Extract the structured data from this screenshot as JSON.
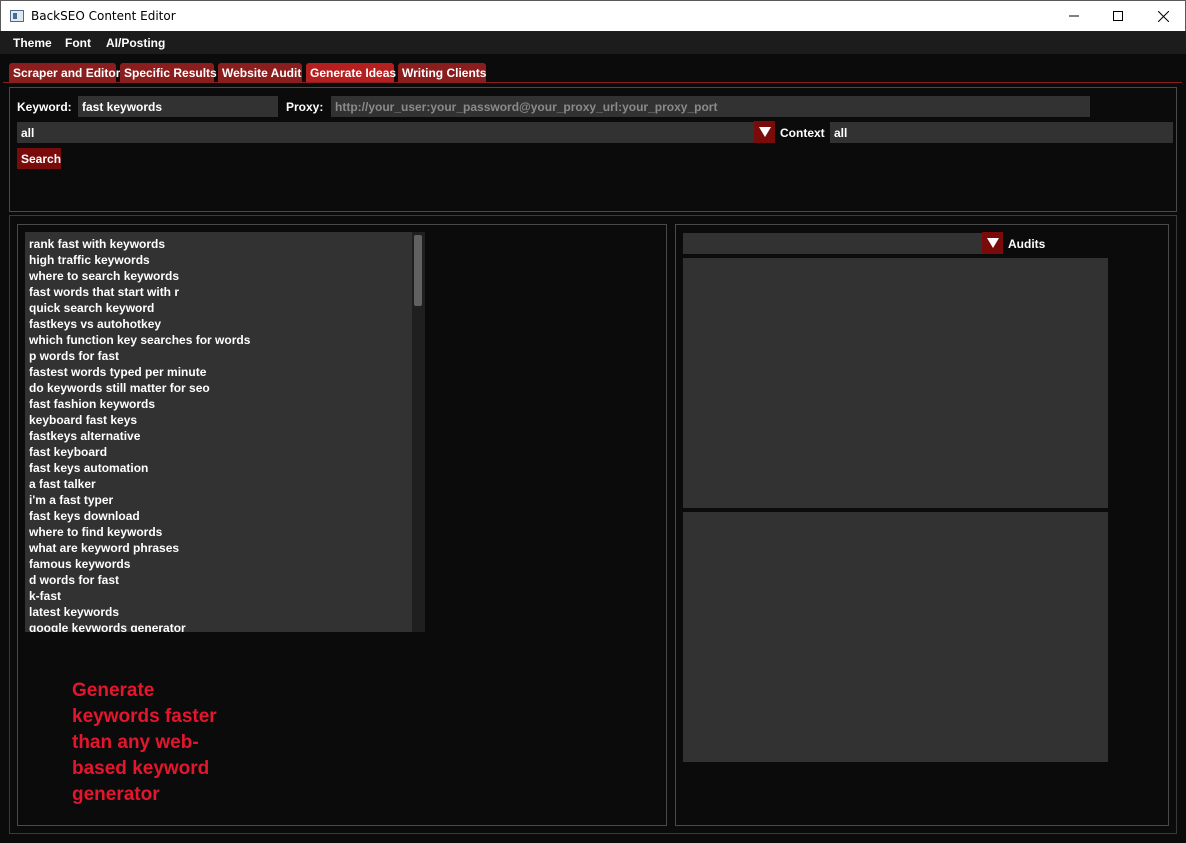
{
  "window": {
    "title": "BackSEO Content Editor",
    "controls": {
      "minimize": "minimize-icon",
      "maximize": "maximize-icon",
      "close": "close-icon"
    }
  },
  "menu": [
    "Theme",
    "Font",
    "AI/Posting"
  ],
  "tabs": [
    {
      "label": "Scraper and Editor"
    },
    {
      "label": "Specific Results"
    },
    {
      "label": "Website Audit"
    },
    {
      "label": "Generate Ideas",
      "active": true
    },
    {
      "label": "Writing Clients"
    }
  ],
  "search": {
    "keyword_label": "Keyword:",
    "keyword_value": "fast keywords",
    "proxy_label": "Proxy:",
    "proxy_placeholder": "http://your_user:your_password@your_proxy_url:your_proxy_port",
    "source_select": "all",
    "context_label": "Context",
    "context_value": "all",
    "search_button": "Search"
  },
  "keywords": [
    " rank fast with keywords",
    "high traffic keywords",
    "where to search keywords",
    "fast words that start with r",
    "quick search keyword",
    "fastkeys vs autohotkey",
    "which function key searches for words",
    "p words for fast",
    "fastest words typed per minute",
    "do keywords still matter for seo",
    "fast fashion keywords",
    "keyboard fast keys",
    "fastkeys alternative",
    "fast keyboard",
    "fast keys automation",
    "a fast talker",
    "i'm a fast typer",
    "fast keys download",
    "where to find keywords",
    "what are keyword phrases",
    "famous keywords",
    "d words for fast",
    "k-fast",
    "latest keywords",
    "google keywords generator"
  ],
  "promo": "Generate keywords faster than any web-based keyword generator",
  "audits": {
    "select_value": "",
    "label": "Audits"
  },
  "colors": {
    "accent": "#7a0b0b",
    "tab": "#8a1d1d",
    "tab_active": "#b51f1f",
    "promo_text": "#e4162d",
    "field_bg": "#323232",
    "background": "#0b0b0b"
  }
}
